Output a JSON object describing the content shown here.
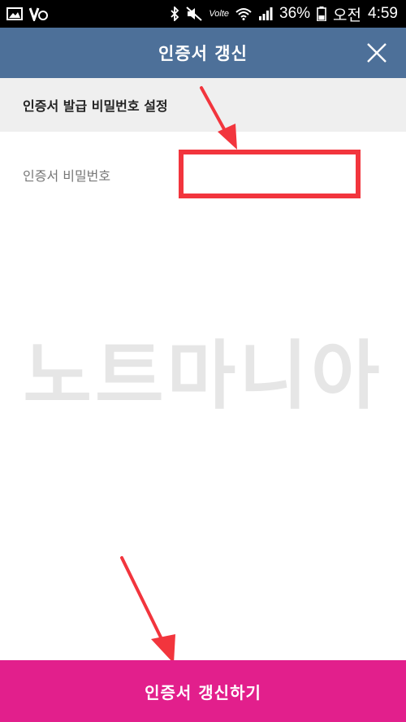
{
  "status_bar": {
    "network_small": "Volte",
    "battery_percent": "36%",
    "ampm": "오전",
    "time": "4:59",
    "icons": [
      "image-icon",
      "v3-icon",
      "bluetooth-icon",
      "mute-icon",
      "wifi-icon",
      "signal-icon",
      "battery-icon"
    ]
  },
  "header": {
    "title": "인증서 갱신",
    "close_icon": "close-icon"
  },
  "section": {
    "title": "인증서 발급 비밀번호 설정"
  },
  "password": {
    "label": "인증서 비밀번호",
    "value": "",
    "placeholder": "",
    "highlight_color": "#f2353d"
  },
  "watermark": {
    "text": "노트마니아"
  },
  "submit": {
    "label": "인증서 갱신하기",
    "color": "#e21f8c"
  },
  "colors": {
    "header_bg": "#4d7099",
    "section_bg": "#efefef",
    "arrow": "#f2353d"
  }
}
